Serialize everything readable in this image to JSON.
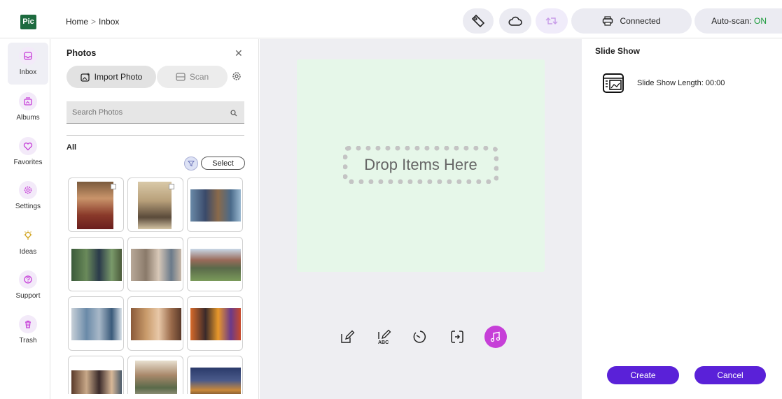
{
  "app": {
    "logo_text": "Pic"
  },
  "breadcrumb": {
    "home": "Home",
    "separator": ">",
    "current": "Inbox"
  },
  "toolbar": {
    "tag_icon": "tag-icon",
    "cloud_icon": "cloud-icon",
    "sync_icon": "sync-icon",
    "printer_status": "Connected",
    "autoscan_label": "Auto-scan: ",
    "autoscan_value": "ON"
  },
  "sidebar": {
    "items": [
      {
        "label": "Inbox",
        "icon": "inbox-icon",
        "active": true
      },
      {
        "label": "Albums",
        "icon": "albums-icon"
      },
      {
        "label": "Favorites",
        "icon": "heart-icon"
      },
      {
        "label": "Settings",
        "icon": "gear-icon"
      },
      {
        "label": "Ideas",
        "icon": "lightbulb-icon"
      },
      {
        "label": "Support",
        "icon": "help-icon"
      },
      {
        "label": "Trash",
        "icon": "trash-icon"
      }
    ]
  },
  "photos": {
    "title": "Photos",
    "import_label": "Import Photo",
    "scan_label": "Scan",
    "search_placeholder": "Search Photos",
    "section_label": "All",
    "select_label": "Select"
  },
  "canvas": {
    "drop_text": "Drop Items Here"
  },
  "slideshow": {
    "title": "Slide Show",
    "length_label": "Slide Show Length: 00:00",
    "create_label": "Create",
    "cancel_label": "Cancel"
  },
  "colors": {
    "accent": "#5a21d8",
    "music": "#c63fd8",
    "dropzone": "#e6f7e9",
    "on": "#1a9a3a"
  }
}
